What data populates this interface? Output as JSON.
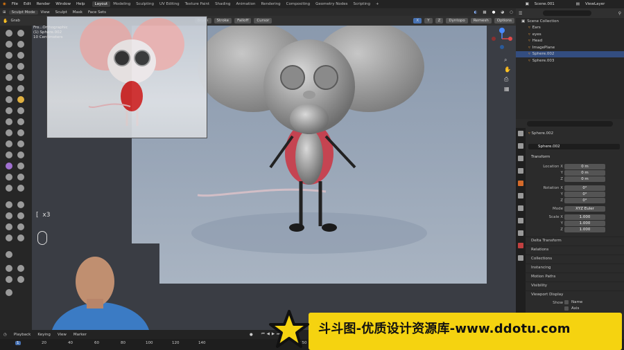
{
  "menu": [
    "File",
    "Edit",
    "Render",
    "Window",
    "Help"
  ],
  "workspaces": [
    "Layout",
    "Modeling",
    "Sculpting",
    "UV Editing",
    "Texture Paint",
    "Shading",
    "Animation",
    "Rendering",
    "Compositing",
    "Geometry Nodes",
    "Scripting",
    "+"
  ],
  "scene": "Scene.001",
  "view_layer": "ViewLayer",
  "mode_header": {
    "mode": "Sculpt Mode",
    "items": [
      "View",
      "Sculpt",
      "Mask",
      "Face Sets"
    ]
  },
  "tool_header": {
    "tool": "Grab",
    "brush_settings": [
      "Brush",
      "Stroke",
      "Falloff",
      "Cursor"
    ],
    "right": [
      "Dyntopo",
      "Remesh",
      "Options"
    ],
    "sym": [
      "X",
      "Y",
      "Z"
    ]
  },
  "viewport_overlay": {
    "line1": "Fro...Orthographic",
    "line2": "(1) Sphere.002",
    "line3": "10 Centimeters"
  },
  "key_hint": {
    "key": "[",
    "count": "x3"
  },
  "outliner": {
    "title": "Scene Collection",
    "items": [
      {
        "name": "Ears"
      },
      {
        "name": "eyes"
      },
      {
        "name": "Head"
      },
      {
        "name": "ImagePlane"
      },
      {
        "name": "Sphere.002"
      },
      {
        "name": "Sphere.003"
      }
    ]
  },
  "properties": {
    "object": "Sphere.002",
    "object_data": "Sphere.002",
    "transform_title": "Transform",
    "location": {
      "label": "Location X",
      "x": "0 m",
      "y": "0 m",
      "z": "0 m"
    },
    "rotation": {
      "label": "Rotation X",
      "x": "0°",
      "y": "0°",
      "z": "0°"
    },
    "mode": {
      "label": "Mode",
      "value": "XYZ Euler"
    },
    "scale": {
      "label": "Scale X",
      "x": "1.000",
      "y": "1.000",
      "z": "1.000"
    },
    "axes": {
      "y": "Y",
      "z": "Z"
    },
    "sections": [
      "Delta Transform",
      "Relations",
      "Collections",
      "Instancing",
      "Motion Paths",
      "Visibility",
      "Viewport Display"
    ],
    "show": {
      "label": "Show",
      "name": "Name",
      "axis": "Axis"
    }
  },
  "timeline": {
    "items": [
      "Playback",
      "Keying",
      "View",
      "Marker"
    ],
    "frames": [
      "1",
      "20",
      "40",
      "60",
      "80",
      "100",
      "120",
      "140",
      "150"
    ],
    "current": "1"
  },
  "watermark": "斗斗图-优质设计资源库-www.ddotu.com",
  "colors": {
    "accent": "#4772b3",
    "selected_row": "#334d80",
    "banner": "#f5d310",
    "ui_bg": "#2b2b2b"
  }
}
